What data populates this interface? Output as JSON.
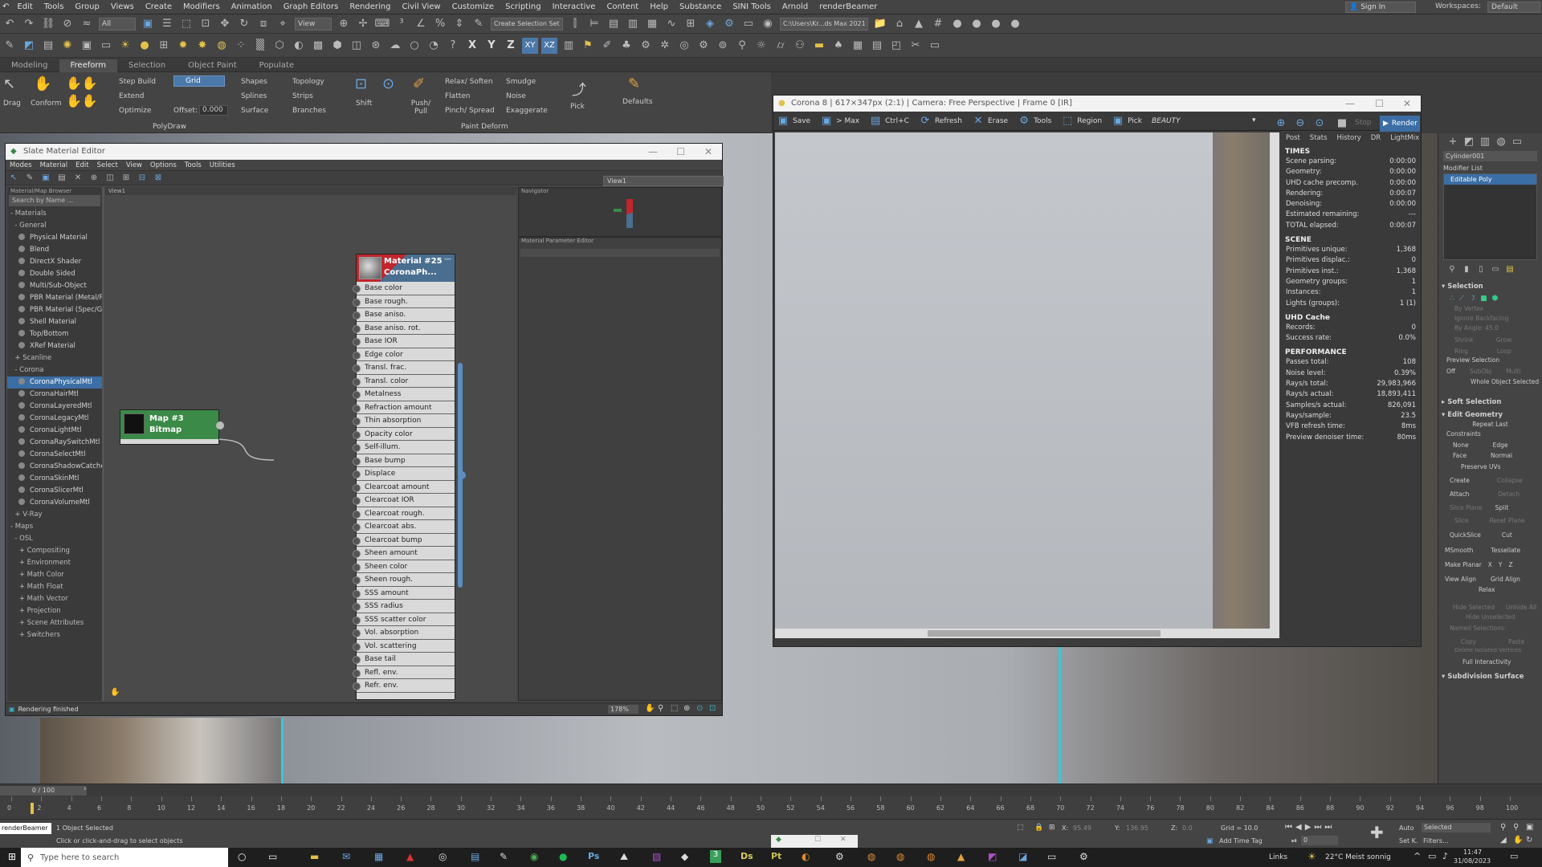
{
  "menu": [
    "Edit",
    "Tools",
    "Group",
    "Views",
    "Create",
    "Modifiers",
    "Animation",
    "Graph Editors",
    "Rendering",
    "Civil View",
    "Customize",
    "Scripting",
    "Interactive",
    "Content",
    "Help",
    "Substance",
    "SINI Tools",
    "Arnold",
    "renderBeamer"
  ],
  "signin": "Sign In",
  "workspaces_label": "Workspaces:",
  "workspaces_value": "Default",
  "toolbar": {
    "filter": "All",
    "view": "View",
    "selection_set": "Create Selection Set",
    "path": "C:\\Users\\Kr...ds Max 2021"
  },
  "ribbon_tabs": [
    "Modeling",
    "Freeform",
    "Selection",
    "Object Paint",
    "Populate"
  ],
  "ribbon": {
    "drag": "Drag",
    "conform": "Conform",
    "step_build": "Step Build",
    "extend": "Extend",
    "optimize": "Optimize",
    "grid": "Grid",
    "offset_label": "Offset:",
    "offset_value": "0.000",
    "shapes": "Shapes",
    "splines": "Splines",
    "surface": "Surface",
    "topology": "Topology",
    "strips": "Strips",
    "branches": "Branches",
    "shift": "Shift",
    "push_pull": "Push/ Pull",
    "relax_soften": "Relax/ Soften",
    "flatten": "Flatten",
    "pinch_spread": "Pinch/ Spread",
    "smudge": "Smudge",
    "noise": "Noise",
    "exaggerate": "Exaggerate",
    "pick": "Pick",
    "defaults": "Defaults",
    "polydraw": "PolyDraw",
    "paint_deform": "Paint Deform"
  },
  "slate": {
    "title": "Slate Material Editor",
    "menu": [
      "Modes",
      "Material",
      "Edit",
      "Select",
      "View",
      "Options",
      "Tools",
      "Utilities"
    ],
    "browser_title": "Material/Map Browser",
    "search": "Search by Name ...",
    "view_tab": "View1",
    "view_dropdown": "View1",
    "browser": [
      {
        "t": "hd",
        "l": "- Materials"
      },
      {
        "t": "hd",
        "l": "  - General"
      },
      {
        "t": "i",
        "l": "Physical Material"
      },
      {
        "t": "i",
        "l": "Blend"
      },
      {
        "t": "i",
        "l": "DirectX Shader"
      },
      {
        "t": "i",
        "l": "Double Sided"
      },
      {
        "t": "i",
        "l": "Multi/Sub-Object"
      },
      {
        "t": "i",
        "l": "PBR Material (Metal/Rough)"
      },
      {
        "t": "i",
        "l": "PBR Material (Spec/Gloss)"
      },
      {
        "t": "i",
        "l": "Shell Material"
      },
      {
        "t": "i",
        "l": "Top/Bottom"
      },
      {
        "t": "i",
        "l": "XRef Material"
      },
      {
        "t": "hd",
        "l": "  + Scanline"
      },
      {
        "t": "hd",
        "l": "  - Corona"
      },
      {
        "t": "s",
        "l": "CoronaPhysicalMtl"
      },
      {
        "t": "i",
        "l": "CoronaHairMtl"
      },
      {
        "t": "i",
        "l": "CoronaLayeredMtl"
      },
      {
        "t": "i",
        "l": "CoronaLegacyMtl"
      },
      {
        "t": "i",
        "l": "CoronaLightMtl"
      },
      {
        "t": "i",
        "l": "CoronaRaySwitchMtl"
      },
      {
        "t": "i",
        "l": "CoronaSelectMtl"
      },
      {
        "t": "i",
        "l": "CoronaShadowCatcherMtl"
      },
      {
        "t": "i",
        "l": "CoronaSkinMtl"
      },
      {
        "t": "i",
        "l": "CoronaSlicerMtl"
      },
      {
        "t": "i",
        "l": "CoronaVolumeMtl"
      },
      {
        "t": "hd",
        "l": "  + V-Ray"
      },
      {
        "t": "hd",
        "l": "- Maps"
      },
      {
        "t": "hd",
        "l": "  - OSL"
      },
      {
        "t": "hd",
        "l": "    + Compositing"
      },
      {
        "t": "hd",
        "l": "    + Environment"
      },
      {
        "t": "hd",
        "l": "    + Math Color"
      },
      {
        "t": "hd",
        "l": "    + Math Float"
      },
      {
        "t": "hd",
        "l": "    + Math Vector"
      },
      {
        "t": "hd",
        "l": "    + Projection"
      },
      {
        "t": "hd",
        "l": "    + Scene Attributes"
      },
      {
        "t": "hd",
        "l": "    + Switchers"
      }
    ],
    "map_node": {
      "l1": "Map #3",
      "l2": "Bitmap"
    },
    "mat_node": {
      "l1": "Material #25",
      "l2": "CoronaPh..."
    },
    "slots": [
      "Base color",
      "Base rough.",
      "Base aniso.",
      "Base aniso. rot.",
      "Base IOR",
      "Edge color",
      "Transl. frac.",
      "Transl. color",
      "Metalness",
      "Refraction amount",
      "Thin absorption",
      "Opacity color",
      "Self-illum.",
      "Base bump",
      "Displace",
      "Clearcoat amount",
      "Clearcoat IOR",
      "Clearcoat rough.",
      "Clearcoat abs.",
      "Clearcoat bump",
      "Sheen amount",
      "Sheen color",
      "Sheen rough.",
      "SSS amount",
      "SSS radius",
      "SSS scatter color",
      "Vol. absorption",
      "Vol. scattering",
      "Base tail",
      "Refl. env.",
      "Refr. env."
    ],
    "navigator": "Navigator",
    "param_editor": "Material Parameter Editor",
    "status": "Rendering finished",
    "zoom": "178%"
  },
  "vfb": {
    "title": "Corona 8 | 617×347px (2:1) | Camera: Free Perspective | Frame 0 [IR]",
    "toolbar": {
      "save": "Save",
      "max": "> Max",
      "ctrlc": "Ctrl+C",
      "refresh": "Refresh",
      "erase": "Erase",
      "tools": "Tools",
      "region": "Region",
      "pick": "Pick",
      "beauty": "BEAUTY",
      "stop": "Stop",
      "render": "Render"
    },
    "tabs": [
      "Post",
      "Stats",
      "History",
      "DR",
      "LightMix"
    ],
    "sections": [
      {
        "h": "TIMES",
        "rows": [
          [
            "Scene parsing:",
            "0:00:00"
          ],
          [
            "Geometry:",
            "0:00:00"
          ],
          [
            "UHD cache precomp.",
            "0:00:00"
          ],
          [
            "Rendering:",
            "0:00:07"
          ],
          [
            "Denoising:",
            "0:00:00"
          ],
          [
            "Estimated remaining:",
            "---"
          ],
          [
            "TOTAL elapsed:",
            "0:00:07"
          ]
        ]
      },
      {
        "h": "SCENE",
        "rows": [
          [
            "Primitives unique:",
            "1,368"
          ],
          [
            "Primitives displac.:",
            "0"
          ],
          [
            "Primitives inst.:",
            "1,368"
          ],
          [
            "Geometry groups:",
            "1"
          ],
          [
            "Instances:",
            "1"
          ],
          [
            "Lights (groups):",
            "1 (1)"
          ]
        ]
      },
      {
        "h": "UHD Cache",
        "rows": [
          [
            "Records:",
            "0"
          ],
          [
            "Success rate:",
            "0.0%"
          ]
        ]
      },
      {
        "h": "PERFORMANCE",
        "rows": [
          [
            "Passes total:",
            "108"
          ],
          [
            "Noise level:",
            "0.39%"
          ],
          [
            "Rays/s total:",
            "29,983,966"
          ],
          [
            "Rays/s actual:",
            "18,893,411"
          ],
          [
            "Samples/s actual:",
            "826,091"
          ],
          [
            "Rays/sample:",
            "23.5"
          ],
          [
            "VFB refresh time:",
            "8ms"
          ],
          [
            "Preview denoiser time:",
            "80ms"
          ]
        ]
      }
    ]
  },
  "cmd": {
    "object": "Cylinder001",
    "modifier_list": "Modifier List",
    "stack_item": "Editable Poly",
    "selection": "Selection",
    "by_vertex": "By Vertex",
    "ignore_backfacing": "Ignore Backfacing",
    "by_angle": "By Angle:",
    "by_angle_val": "45.0",
    "shrink": "Shrink",
    "grow": "Grow",
    "ring": "Ring",
    "loop": "Loop",
    "preview_selection": "Preview Selection",
    "off": "Off",
    "subobj": "SubObj",
    "multi": "Multi",
    "whole_object": "Whole Object Selected",
    "soft_selection": "Soft Selection",
    "edit_geometry": "Edit Geometry",
    "repeat_last": "Repeat Last",
    "constraints": "Constraints",
    "none": "None",
    "edge": "Edge",
    "face": "Face",
    "normal": "Normal",
    "preserve_uvs": "Preserve UVs",
    "create": "Create",
    "collapse": "Collapse",
    "attach": "Attach",
    "detach": "Detach",
    "slice_plane": "Slice Plane",
    "split": "Split",
    "slice": "Slice",
    "reset_plane": "Reset Plane",
    "quickslice": "QuickSlice",
    "cut": "Cut",
    "msmooth": "MSmooth",
    "tessellate": "Tessellate",
    "make_planar": "Make Planar",
    "x": "X",
    "y": "Y",
    "z": "Z",
    "view_align": "View Align",
    "grid_align": "Grid Align",
    "relax": "Relax",
    "hide_selected": "Hide Selected",
    "unhide_all": "Unhide All",
    "hide_unselected": "Hide Unselected",
    "named_selections": "Named Selections:",
    "copy": "Copy",
    "paste": "Paste",
    "delete_isolated": "Delete Isolated Vertices",
    "full_interactivity": "Full Interactivity",
    "subdivision_surface": "Subdivision Surface"
  },
  "timeline": {
    "frame": "0 / 100",
    "ticks": [
      "0",
      "2",
      "4",
      "6",
      "8",
      "10",
      "12",
      "14",
      "16",
      "18",
      "20",
      "22",
      "24",
      "26",
      "28",
      "30",
      "32",
      "34",
      "36",
      "38",
      "40",
      "42",
      "44",
      "46",
      "48",
      "50",
      "52",
      "54",
      "56",
      "58",
      "60",
      "62",
      "64",
      "66",
      "68",
      "70",
      "72",
      "74",
      "76",
      "78",
      "80",
      "82",
      "84",
      "86",
      "88",
      "90",
      "92",
      "94",
      "96",
      "98",
      "100"
    ]
  },
  "status": {
    "maxscript": "renderBeamer",
    "selected": "1 Object Selected",
    "hint": "Click or click-and-drag to select objects",
    "x_label": "X:",
    "x_val": "95.49",
    "y_label": "Y:",
    "y_val": "136.95",
    "z_label": "Z:",
    "z_val": "0.0",
    "grid": "Grid = 10.0",
    "add_time_tag": "Add Time Tag",
    "auto": "Auto",
    "setk": "Set K.",
    "selected_mode": "Selected",
    "filters": "Filters...",
    "frame_field": "0"
  },
  "taskbar": {
    "search": "Type here to search",
    "links": "Links",
    "weather": "22°C  Meist sonnig",
    "time": "11:47",
    "date": "31/08/2023"
  }
}
